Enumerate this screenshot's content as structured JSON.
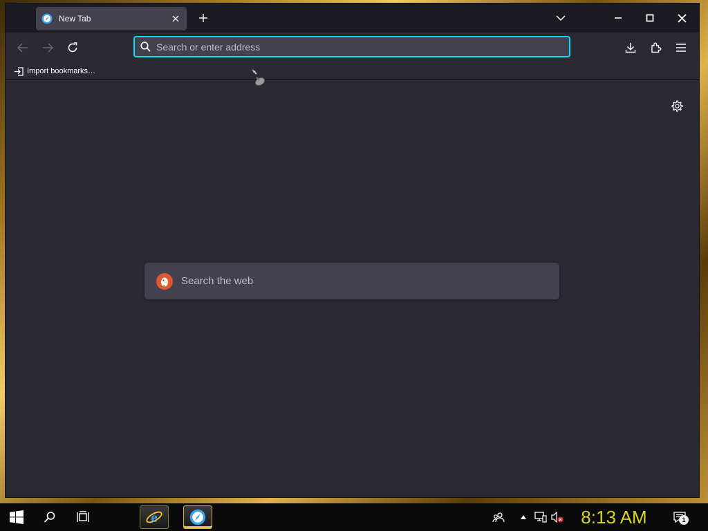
{
  "browser": {
    "tab": {
      "title": "New Tab"
    },
    "urlbar": {
      "placeholder": "Search or enter address"
    },
    "bookmarks": {
      "import_label": "Import bookmarks…"
    },
    "newtab": {
      "search_placeholder": "Search the web"
    }
  },
  "taskbar": {
    "clock": "8:13 AM",
    "notification_count": "1",
    "apps": [
      {
        "name": "Internet Explorer"
      },
      {
        "name": "Web Browser"
      }
    ]
  },
  "colors": {
    "accent": "#00ddff",
    "window_bg": "#2b2a33",
    "titlebar_bg": "#1c1b22",
    "field_bg": "#42414d",
    "clock": "#d7d41d",
    "search_engine": "#de5833"
  },
  "icons": [
    "browser-favicon-icon",
    "close-icon",
    "plus-icon",
    "chevron-down-icon",
    "minimize-icon",
    "maximize-icon",
    "back-arrow-icon",
    "forward-arrow-icon",
    "reload-icon",
    "search-icon",
    "download-icon",
    "extensions-icon",
    "menu-icon",
    "import-icon",
    "gear-icon",
    "duckduckgo-icon",
    "windows-start-icon",
    "search-icon",
    "task-view-icon",
    "ie-icon",
    "people-icon",
    "chevron-up-icon",
    "network-icon",
    "volume-muted-icon",
    "notifications-icon"
  ]
}
